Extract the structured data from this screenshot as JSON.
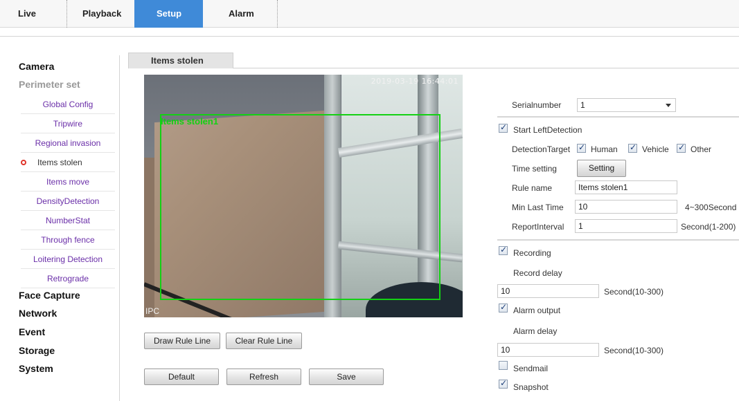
{
  "topnav": {
    "tabs": [
      {
        "label": "Live",
        "active": false
      },
      {
        "label": "Playback",
        "active": false
      },
      {
        "label": "Setup",
        "active": true
      },
      {
        "label": "Alarm",
        "active": false
      }
    ],
    "active_color": "#3f8ad8"
  },
  "sidebar": {
    "camera": "Camera",
    "perimeter": "Perimeter set",
    "items": [
      {
        "label": "Global Config"
      },
      {
        "label": "Tripwire"
      },
      {
        "label": "Regional invasion"
      },
      {
        "label": "Items stolen",
        "active": true
      },
      {
        "label": "Items move"
      },
      {
        "label": "DensityDetection"
      },
      {
        "label": "NumberStat"
      },
      {
        "label": "Through fence"
      },
      {
        "label": "Loitering Detection"
      },
      {
        "label": "Retrograde"
      }
    ],
    "sections": [
      "Face Capture",
      "Network",
      "Event",
      "Storage",
      "System"
    ],
    "item_color": "#6a2ea8"
  },
  "content": {
    "tab_title": "Items stolen",
    "video": {
      "timestamp": "2019-03-19 16:44:01",
      "channel": "IPC",
      "rule_label": "Items stolen1",
      "rule_color": "#13d113"
    },
    "buttons": {
      "draw_rule": "Draw Rule Line",
      "clear_rule": "Clear Rule Line",
      "default": "Default",
      "refresh": "Refresh",
      "save": "Save"
    },
    "config": {
      "serial_label": "Serialnumber",
      "serial_value": "1",
      "start_detection_label": "Start LeftDetection",
      "start_detection_checked": true,
      "detection_target_label": "DetectionTarget",
      "targets": [
        {
          "label": "Human",
          "checked": true
        },
        {
          "label": "Vehicle",
          "checked": true
        },
        {
          "label": "Other",
          "checked": true
        }
      ],
      "time_setting_label": "Time setting",
      "setting_button": "Setting",
      "rule_name_label": "Rule name",
      "rule_name_value": "Items stolen1",
      "min_last_time_label": "Min Last Time",
      "min_last_time_value": "10",
      "min_last_time_hint": "4~300Second",
      "report_interval_label": "ReportInterval",
      "report_interval_value": "1",
      "report_interval_hint": "Second(1-200)",
      "recording_label": "Recording",
      "recording_checked": true,
      "record_delay_label": "Record delay",
      "record_delay_value": "10",
      "record_delay_hint": "Second(10-300)",
      "alarm_output_label": "Alarm output",
      "alarm_output_checked": true,
      "alarm_delay_label": "Alarm delay",
      "alarm_delay_value": "10",
      "alarm_delay_hint": "Second(10-300)",
      "sendmail_label": "Sendmail",
      "sendmail_checked": false,
      "snapshot_label": "Snapshot",
      "snapshot_checked": true
    }
  }
}
